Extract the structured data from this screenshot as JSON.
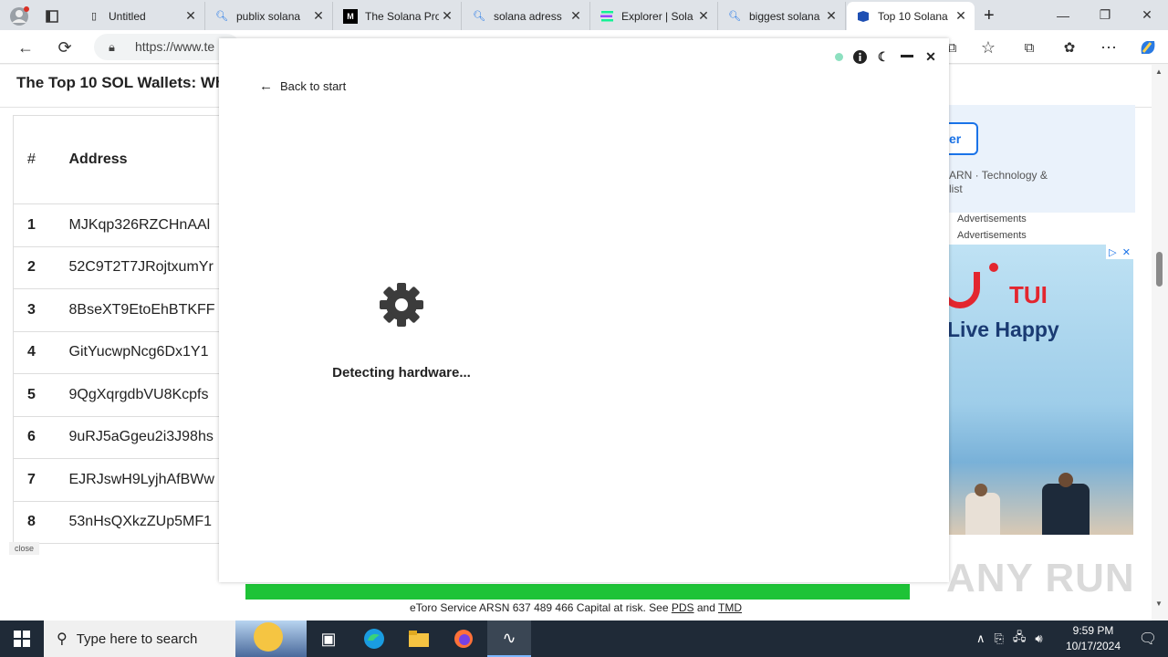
{
  "browser": {
    "tabs": [
      {
        "label": "Untitled",
        "icon": "page-icon"
      },
      {
        "label": "publix solana",
        "icon": "search-icon"
      },
      {
        "label": "The Solana Pro",
        "icon": "medium-icon"
      },
      {
        "label": "solana adress",
        "icon": "search-icon"
      },
      {
        "label": "Explorer | Sola",
        "icon": "solana-icon"
      },
      {
        "label": "biggest solana",
        "icon": "search-icon"
      },
      {
        "label": "Top 10 Solana",
        "icon": "site-icon"
      }
    ],
    "close_glyph": "✕",
    "new_tab_glyph": "+",
    "url": "https://www.te"
  },
  "page": {
    "title": "The Top 10 SOL Wallets: Who",
    "table": {
      "headers": [
        "#",
        "Address"
      ],
      "rows": [
        {
          "rank": "1",
          "address": "MJKqp326RZCHnAAl"
        },
        {
          "rank": "2",
          "address": "52C9T2T7JRojtxumYr"
        },
        {
          "rank": "3",
          "address": "8BseXT9EtoEhBTKFF"
        },
        {
          "rank": "4",
          "address": "GitYucwpNcg6Dx1Y1"
        },
        {
          "rank": "5",
          "address": "9QgXqrgdbVU8Kcpfs"
        },
        {
          "rank": "6",
          "address": "9uRJ5aGgeu2i3J98hs"
        },
        {
          "rank": "7",
          "address": "EJRJswH9LyjhAfBWw"
        },
        {
          "rank": "8",
          "address": "53nHsQXkzZUp5MF1"
        }
      ]
    },
    "close_label": "close",
    "ad_button_text": "er",
    "ad_note_line1": "ARN · Technology &",
    "ad_note_line2": "list",
    "advertisements_1": "Advertisements",
    "advertisements_2": "Advertisements",
    "tui_logo": "TUI",
    "tui_tagline": "Live Happy",
    "disclaimer_pre": "eToro Service ARSN 637 489 466 Capital at risk. See ",
    "disclaimer_pds": "PDS",
    "disclaimer_and": " and ",
    "disclaimer_tmd": "TMD",
    "watermark": "ANY RUN"
  },
  "modal": {
    "back_label": "Back to start",
    "status_text": "Detecting hardware...",
    "status_dot_color": "#8de0c0"
  },
  "taskbar": {
    "search_placeholder": "Type here to search",
    "time": "9:59 PM",
    "date": "10/17/2024"
  }
}
